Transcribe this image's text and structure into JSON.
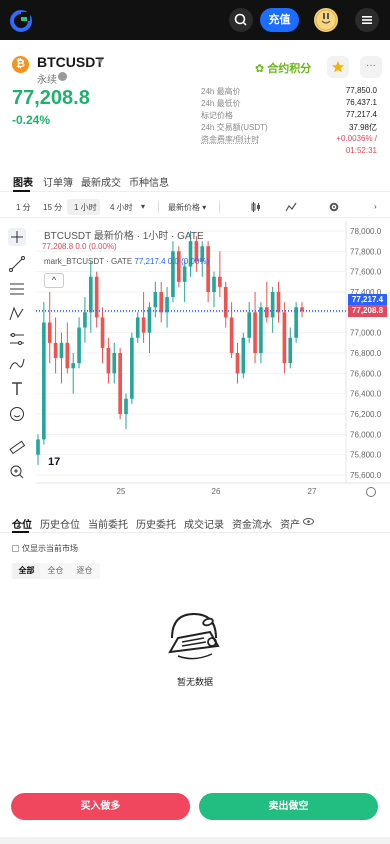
{
  "header": {
    "charge_label": "充值",
    "colors": {
      "bar": "#111111",
      "charge": "#1b6cff"
    },
    "icons": [
      "app-logo-icon",
      "search-icon",
      "avatar",
      "menu-icon"
    ]
  },
  "ticker": {
    "symbol": "BTCUSDT",
    "contract_type": "永续",
    "last_price": "77,208.8",
    "change_pct": "-0.24%",
    "points_label": "合约积分",
    "stats": [
      {
        "label": "24h 最高价",
        "value": "77,850.0"
      },
      {
        "label": "24h 最低价",
        "value": "76,437.1"
      },
      {
        "label": "标记价格",
        "value": "77,217.4"
      },
      {
        "label": "24h 交易额(USDT)",
        "value": "37.98亿"
      },
      {
        "label": "资金费率/倒计时",
        "value": "+0.0036% /",
        "value2": "01:52:31"
      }
    ]
  },
  "tabs": [
    "图表",
    "订单簿",
    "最新成交",
    "币种信息"
  ],
  "intervals": {
    "items": [
      "1 分",
      "15 分",
      "1 小时",
      "4 小时"
    ],
    "active": "1 小时",
    "price_type": "最新价格"
  },
  "chart": {
    "legend_title": "BTCUSDT 最新价格 · 1小时 · GATE",
    "legend_values": "77,208.8  0.0 (0.00%)",
    "legend_mark_label": "mark_BTCUSDT · GATE",
    "legend_mark_values": "77,217.4  0.0 (0.00%)",
    "mark_price_tag": "77,217.4",
    "last_price_tag": "77,208.8",
    "tv_logo": "17",
    "collapse_glyph": "^",
    "colors": {
      "up": "#26a69a",
      "down": "#ef5350",
      "mark": "#2962ff",
      "last": "#e04a5f"
    }
  },
  "chart_data": {
    "type": "candlestick",
    "title": "BTCUSDT 最新价格 · 1小时 · GATE",
    "y_ticks": [
      "78,000.0",
      "77,800.0",
      "77,600.0",
      "77,400.0",
      "77,200.0",
      "77,000.0",
      "76,800.0",
      "76,600.0",
      "76,400.0",
      "76,200.0",
      "76,000.0",
      "75,800.0",
      "75,600.0"
    ],
    "ylim": [
      75600,
      78000
    ],
    "x_ticks": [
      "25",
      "26",
      "27"
    ],
    "candles": [
      [
        75800,
        76000,
        75700,
        75950
      ],
      [
        75950,
        77300,
        75900,
        77100
      ],
      [
        77100,
        77400,
        76700,
        76900
      ],
      [
        76900,
        77150,
        76600,
        76750
      ],
      [
        76750,
        77000,
        76500,
        76900
      ],
      [
        76900,
        77100,
        76600,
        76650
      ],
      [
        76650,
        76800,
        76400,
        76700
      ],
      [
        76700,
        77150,
        76650,
        77050
      ],
      [
        77050,
        77350,
        76900,
        77200
      ],
      [
        77200,
        77700,
        77000,
        77550
      ],
      [
        77550,
        77600,
        77050,
        77150
      ],
      [
        77150,
        77250,
        76700,
        76850
      ],
      [
        76850,
        76950,
        76500,
        76600
      ],
      [
        76600,
        76900,
        76500,
        76800
      ],
      [
        76800,
        76850,
        76150,
        76200
      ],
      [
        76200,
        76400,
        76050,
        76350
      ],
      [
        76350,
        77000,
        76300,
        76950
      ],
      [
        76950,
        77200,
        76900,
        77150
      ],
      [
        77150,
        77400,
        76900,
        77000
      ],
      [
        77000,
        77300,
        76800,
        77250
      ],
      [
        77250,
        77500,
        77150,
        77400
      ],
      [
        77400,
        77500,
        77100,
        77200
      ],
      [
        77200,
        77450,
        77050,
        77350
      ],
      [
        77350,
        77900,
        77300,
        77800
      ],
      [
        77800,
        77850,
        77450,
        77500
      ],
      [
        77500,
        77700,
        77300,
        77650
      ],
      [
        77650,
        78000,
        77550,
        77900
      ],
      [
        77900,
        77950,
        77600,
        77700
      ],
      [
        77700,
        77900,
        77550,
        77850
      ],
      [
        77850,
        77900,
        77300,
        77400
      ],
      [
        77400,
        77600,
        77250,
        77550
      ],
      [
        77550,
        77800,
        77350,
        77450
      ],
      [
        77450,
        77500,
        77050,
        77150
      ],
      [
        77150,
        77300,
        76750,
        76800
      ],
      [
        76800,
        76900,
        76500,
        76600
      ],
      [
        76600,
        77000,
        76550,
        76950
      ],
      [
        76950,
        77300,
        76900,
        77200
      ],
      [
        77200,
        77400,
        76700,
        76800
      ],
      [
        76800,
        77300,
        76700,
        77250
      ],
      [
        77250,
        77500,
        77100,
        77150
      ],
      [
        77150,
        77450,
        77000,
        77400
      ],
      [
        77400,
        77500,
        77100,
        77200
      ],
      [
        77200,
        77300,
        76600,
        76700
      ],
      [
        76700,
        77050,
        76650,
        76950
      ],
      [
        76950,
        77300,
        76900,
        77250
      ],
      [
        77250,
        77300,
        77150,
        77210
      ]
    ],
    "candle_x_range": [
      "24 20:00",
      "26 17:00"
    ],
    "lines": [
      {
        "name": "mark_BTCUSDT",
        "value": 77217.4
      },
      {
        "name": "BTCUSDT",
        "value": 77208.8
      }
    ]
  },
  "positions": {
    "tabs": [
      "仓位",
      "历史仓位",
      "当前委托",
      "历史委托",
      "成交记录",
      "资金流水",
      "资产"
    ],
    "only_current_label": "仅显示当前市场",
    "filters": [
      "全部",
      "全仓",
      "逐仓"
    ],
    "empty_text": "暂无数据"
  },
  "actions": {
    "buy_label": "买入做多",
    "sell_label": "卖出做空",
    "buy_color": "#f0475f",
    "sell_color": "#22bd80"
  }
}
